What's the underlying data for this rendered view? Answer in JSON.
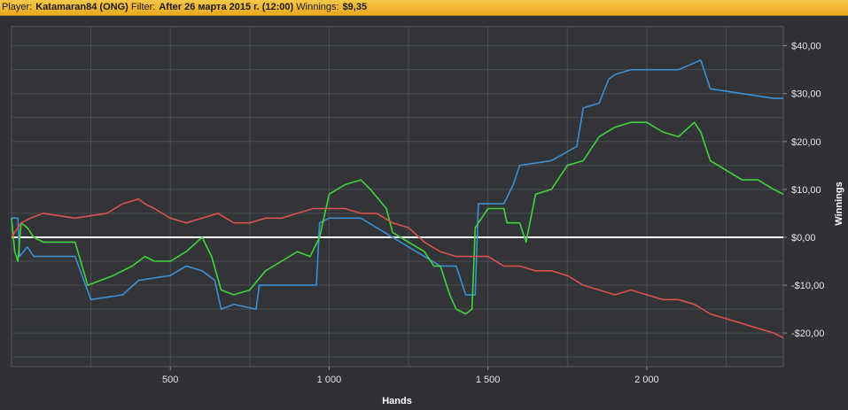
{
  "header": {
    "player_label": "Player:",
    "player_value": "Katamaran84 (ONG)",
    "filter_label": "Filter:",
    "filter_value": "After 26 марта 2015 г. (12:00)",
    "winnings_label": "Winnings:",
    "winnings_value": "$9,35"
  },
  "chart_data": {
    "type": "line",
    "xlabel": "Hands",
    "ylabel": "Winnings",
    "xlim": [
      0,
      2430
    ],
    "ylim": [
      -27,
      44
    ],
    "x_ticks": [
      500,
      1000,
      1500,
      2000
    ],
    "x_tick_labels": [
      "500",
      "1 000",
      "1 500",
      "2 000"
    ],
    "y_ticks": [
      40,
      30,
      20,
      10,
      0,
      -10,
      -20
    ],
    "y_tick_labels": [
      "$40,00",
      "$30,00",
      "$20,00",
      "$10,00",
      "$0,00",
      "-$10,00",
      "-$20,00"
    ],
    "grid": true,
    "zero_line": true,
    "colors": {
      "blue": "#3d8fd4",
      "green": "#3fd43a",
      "red": "#d9534f",
      "zero": "#ffffff",
      "grid": "#4a4d52"
    },
    "series": [
      {
        "color": "blue",
        "points": [
          [
            0,
            4
          ],
          [
            20,
            4
          ],
          [
            25,
            -4
          ],
          [
            50,
            -2
          ],
          [
            70,
            -4
          ],
          [
            200,
            -4
          ],
          [
            250,
            -13
          ],
          [
            350,
            -12
          ],
          [
            400,
            -9
          ],
          [
            500,
            -8
          ],
          [
            550,
            -6
          ],
          [
            600,
            -7
          ],
          [
            640,
            -9
          ],
          [
            660,
            -15
          ],
          [
            700,
            -14
          ],
          [
            770,
            -15
          ],
          [
            780,
            -10
          ],
          [
            850,
            -10
          ],
          [
            900,
            -10
          ],
          [
            960,
            -10
          ],
          [
            970,
            3
          ],
          [
            1000,
            4
          ],
          [
            1100,
            4
          ],
          [
            1200,
            0
          ],
          [
            1250,
            -2
          ],
          [
            1300,
            -4
          ],
          [
            1350,
            -6
          ],
          [
            1400,
            -6
          ],
          [
            1430,
            -12
          ],
          [
            1460,
            -12
          ],
          [
            1470,
            7
          ],
          [
            1550,
            7
          ],
          [
            1580,
            11
          ],
          [
            1600,
            15
          ],
          [
            1700,
            16
          ],
          [
            1780,
            19
          ],
          [
            1800,
            27
          ],
          [
            1850,
            28
          ],
          [
            1880,
            33
          ],
          [
            1900,
            34
          ],
          [
            1950,
            35
          ],
          [
            2000,
            35
          ],
          [
            2100,
            35
          ],
          [
            2170,
            37
          ],
          [
            2200,
            31
          ],
          [
            2300,
            30
          ],
          [
            2400,
            29
          ],
          [
            2430,
            29
          ]
        ]
      },
      {
        "color": "green",
        "points": [
          [
            0,
            4
          ],
          [
            10,
            -3
          ],
          [
            20,
            -5
          ],
          [
            30,
            3
          ],
          [
            50,
            2
          ],
          [
            70,
            0
          ],
          [
            100,
            -1
          ],
          [
            150,
            -1
          ],
          [
            200,
            -1
          ],
          [
            240,
            -10
          ],
          [
            280,
            -9
          ],
          [
            320,
            -8
          ],
          [
            380,
            -6
          ],
          [
            420,
            -4
          ],
          [
            450,
            -5
          ],
          [
            500,
            -5
          ],
          [
            550,
            -3
          ],
          [
            600,
            0
          ],
          [
            630,
            -4
          ],
          [
            660,
            -11
          ],
          [
            700,
            -12
          ],
          [
            750,
            -11
          ],
          [
            800,
            -7
          ],
          [
            850,
            -5
          ],
          [
            900,
            -3
          ],
          [
            940,
            -4
          ],
          [
            970,
            0
          ],
          [
            1000,
            9
          ],
          [
            1050,
            11
          ],
          [
            1100,
            12
          ],
          [
            1130,
            10
          ],
          [
            1180,
            6
          ],
          [
            1200,
            1
          ],
          [
            1250,
            -1
          ],
          [
            1300,
            -3
          ],
          [
            1330,
            -6
          ],
          [
            1350,
            -6
          ],
          [
            1380,
            -12
          ],
          [
            1400,
            -15
          ],
          [
            1430,
            -16
          ],
          [
            1450,
            -15
          ],
          [
            1460,
            2
          ],
          [
            1500,
            6
          ],
          [
            1550,
            6
          ],
          [
            1560,
            3
          ],
          [
            1600,
            3
          ],
          [
            1620,
            -1
          ],
          [
            1650,
            9
          ],
          [
            1700,
            10
          ],
          [
            1750,
            15
          ],
          [
            1800,
            16
          ],
          [
            1850,
            21
          ],
          [
            1900,
            23
          ],
          [
            1950,
            24
          ],
          [
            2000,
            24
          ],
          [
            2050,
            22
          ],
          [
            2100,
            21
          ],
          [
            2150,
            24
          ],
          [
            2170,
            22
          ],
          [
            2200,
            16
          ],
          [
            2250,
            14
          ],
          [
            2300,
            12
          ],
          [
            2350,
            12
          ],
          [
            2400,
            10
          ],
          [
            2430,
            9
          ]
        ]
      },
      {
        "color": "red",
        "points": [
          [
            0,
            0
          ],
          [
            30,
            3
          ],
          [
            60,
            4
          ],
          [
            100,
            5
          ],
          [
            200,
            4
          ],
          [
            300,
            5
          ],
          [
            350,
            7
          ],
          [
            400,
            8
          ],
          [
            420,
            7
          ],
          [
            450,
            6
          ],
          [
            500,
            4
          ],
          [
            550,
            3
          ],
          [
            600,
            4
          ],
          [
            650,
            5
          ],
          [
            700,
            3
          ],
          [
            750,
            3
          ],
          [
            800,
            4
          ],
          [
            850,
            4
          ],
          [
            900,
            5
          ],
          [
            950,
            6
          ],
          [
            1000,
            6
          ],
          [
            1050,
            6
          ],
          [
            1100,
            5
          ],
          [
            1150,
            5
          ],
          [
            1200,
            3
          ],
          [
            1250,
            2
          ],
          [
            1300,
            -1
          ],
          [
            1350,
            -3
          ],
          [
            1400,
            -4
          ],
          [
            1450,
            -4
          ],
          [
            1500,
            -4
          ],
          [
            1550,
            -6
          ],
          [
            1600,
            -6
          ],
          [
            1650,
            -7
          ],
          [
            1700,
            -7
          ],
          [
            1750,
            -8
          ],
          [
            1800,
            -10
          ],
          [
            1850,
            -11
          ],
          [
            1900,
            -12
          ],
          [
            1950,
            -11
          ],
          [
            2000,
            -12
          ],
          [
            2050,
            -13
          ],
          [
            2100,
            -13
          ],
          [
            2150,
            -14
          ],
          [
            2200,
            -16
          ],
          [
            2250,
            -17
          ],
          [
            2300,
            -18
          ],
          [
            2350,
            -19
          ],
          [
            2400,
            -20
          ],
          [
            2430,
            -21
          ]
        ]
      }
    ]
  }
}
